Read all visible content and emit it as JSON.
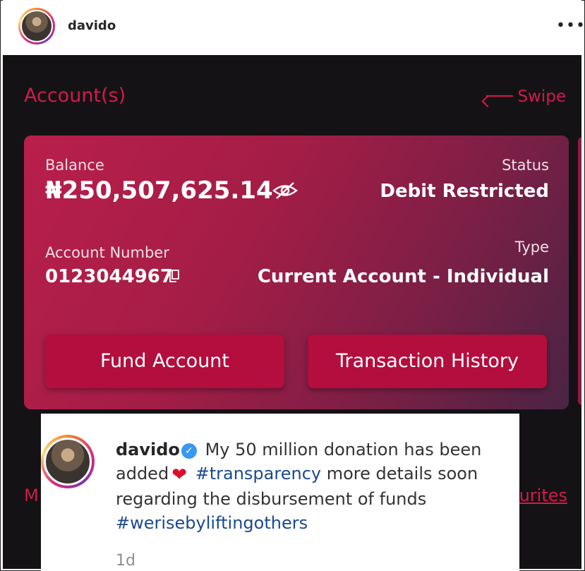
{
  "post": {
    "username": "davido",
    "more_label": "•••"
  },
  "app": {
    "section_title": "Account(s)",
    "swipe_label": "Swipe",
    "balance_label": "Balance",
    "balance_value": "₦250,507,625.14",
    "status_label": "Status",
    "status_value": "Debit Restricted",
    "account_number_label": "Account Number",
    "account_number_value": "0123044967",
    "type_label": "Type",
    "type_value": "Current Account - Individual",
    "fund_button": "Fund Account",
    "history_button": "Transaction History",
    "bottom_left_partial": "M",
    "bottom_right_partial": "ourites"
  },
  "comment": {
    "username": "davido",
    "text_1": "My 50 million donation has been added",
    "hashtag_1": "#transparency",
    "text_2": "more details soon regarding the disbursement of funds",
    "hashtag_2": "#werisebyliftingothers",
    "time": "1d"
  }
}
